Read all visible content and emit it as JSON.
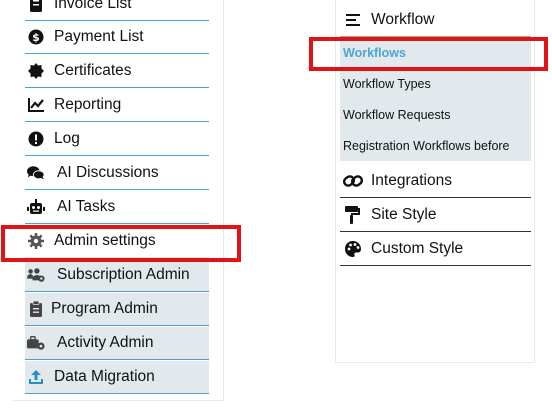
{
  "left_menu": {
    "items": [
      {
        "label": "Invoice List",
        "icon": "invoice-icon"
      },
      {
        "label": "Payment List",
        "icon": "payment-icon"
      },
      {
        "label": "Certificates",
        "icon": "certificate-icon"
      },
      {
        "label": "Reporting",
        "icon": "chart-icon"
      },
      {
        "label": "Log",
        "icon": "alert-circle-icon"
      },
      {
        "label": "AI Discussions",
        "icon": "chat-icon"
      },
      {
        "label": "AI Tasks",
        "icon": "robot-icon"
      },
      {
        "label": "Admin settings",
        "icon": "gear-icon"
      },
      {
        "label": "Subscription Admin",
        "icon": "users-gear-icon"
      },
      {
        "label": "Program Admin",
        "icon": "clipboard-icon"
      },
      {
        "label": "Activity Admin",
        "icon": "briefcase-gear-icon"
      },
      {
        "label": "Data Migration",
        "icon": "upload-icon"
      }
    ]
  },
  "right_menu": {
    "workflow_header": {
      "label": "Workflow",
      "icon": "menu-lines-icon"
    },
    "workflow_items": [
      {
        "label": "Workflows",
        "active": true
      },
      {
        "label": "Workflow Types",
        "active": false
      },
      {
        "label": "Workflow Requests",
        "active": false
      },
      {
        "label": "Registration Workflows before",
        "active": false
      }
    ],
    "items": [
      {
        "label": "Integrations",
        "icon": "link-icon"
      },
      {
        "label": "Site Style",
        "icon": "paint-roller-icon"
      },
      {
        "label": "Custom Style",
        "icon": "palette-icon"
      }
    ]
  },
  "colors": {
    "highlight": "#e01414",
    "row_border": "#4aa0c8",
    "shaded_row": "#e2e9ed",
    "active_link": "#4ea5d6"
  }
}
